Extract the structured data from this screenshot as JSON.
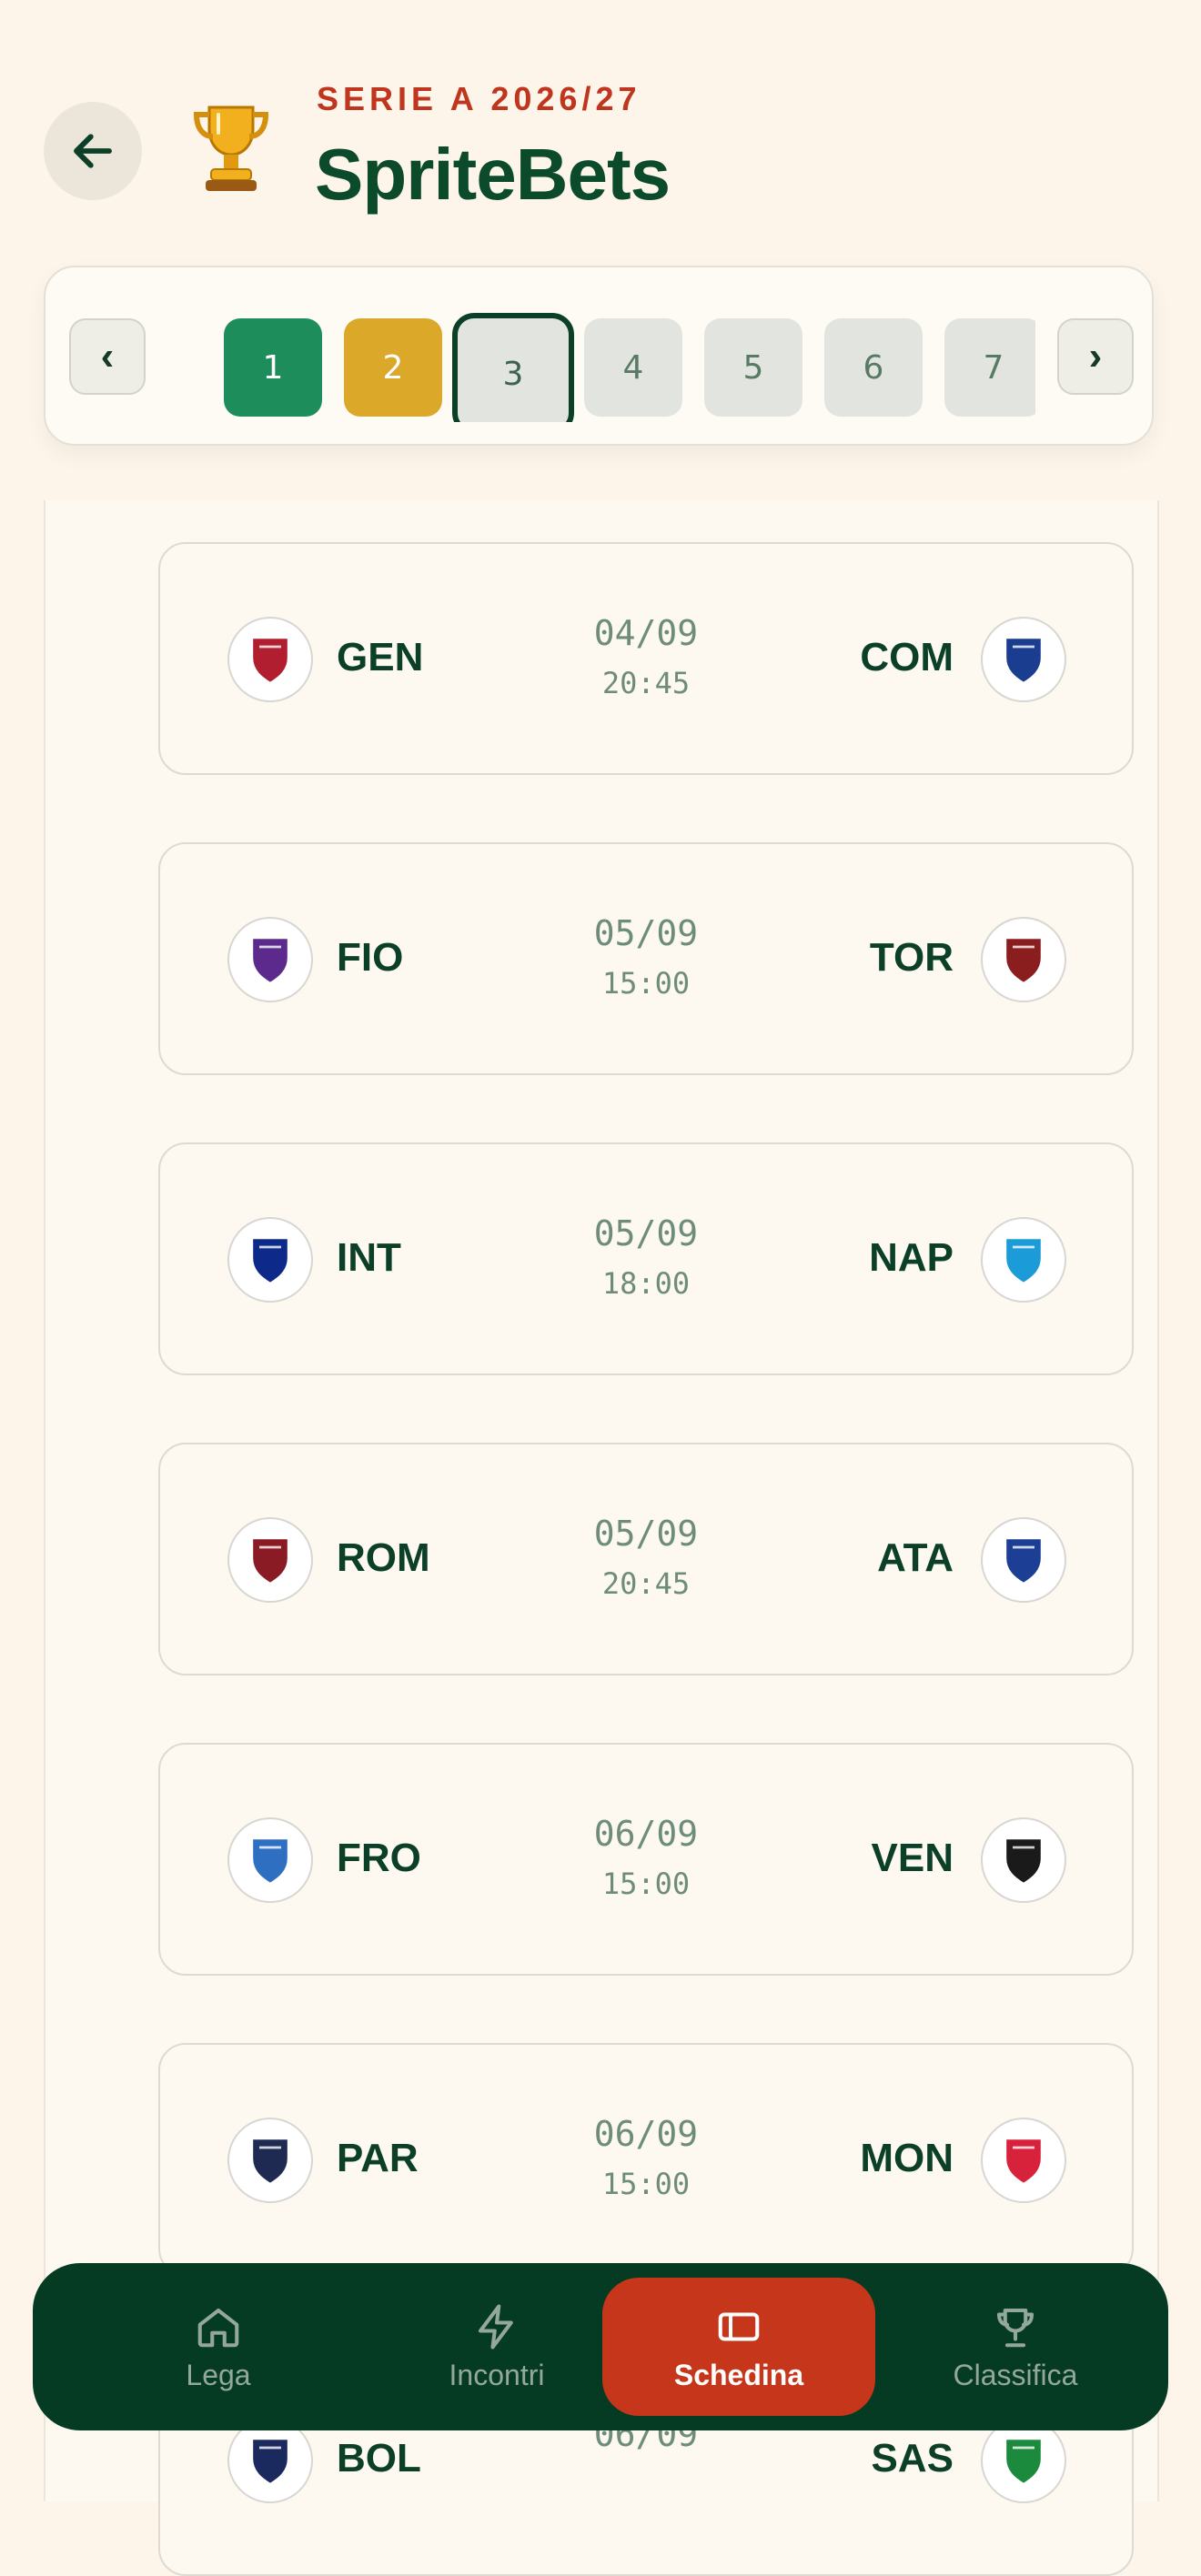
{
  "header": {
    "league": "SERIE A 2026/27",
    "title": "SpriteBets"
  },
  "rounds": {
    "prev_label": "‹",
    "next_label": "›",
    "items": [
      "1",
      "2",
      "3",
      "4",
      "5",
      "6",
      "7"
    ],
    "status": [
      "done",
      "live",
      "current",
      "upcoming",
      "upcoming",
      "upcoming",
      "upcoming"
    ],
    "selected": "3"
  },
  "matches": [
    {
      "home": "GEN",
      "away": "COM",
      "date": "04/09",
      "time": "20:45",
      "home_color": "#b01e2f",
      "away_color": "#1a3d8f"
    },
    {
      "home": "FIO",
      "away": "TOR",
      "date": "05/09",
      "time": "15:00",
      "home_color": "#5b2a8c",
      "away_color": "#8a1d1d"
    },
    {
      "home": "INT",
      "away": "NAP",
      "date": "05/09",
      "time": "18:00",
      "home_color": "#0d2a8a",
      "away_color": "#1b9bd8"
    },
    {
      "home": "ROM",
      "away": "ATA",
      "date": "05/09",
      "time": "20:45",
      "home_color": "#8a1a23",
      "away_color": "#1c3f95"
    },
    {
      "home": "FRO",
      "away": "VEN",
      "date": "06/09",
      "time": "15:00",
      "home_color": "#2f6fc2",
      "away_color": "#1a1a1a"
    },
    {
      "home": "PAR",
      "away": "MON",
      "date": "06/09",
      "time": "15:00",
      "home_color": "#1f2a52",
      "away_color": "#d8213a"
    },
    {
      "home": "BOL",
      "away": "SAS",
      "date": "06/09",
      "time": "",
      "home_color": "#1a2a5e",
      "away_color": "#1b8a3c"
    }
  ],
  "nav": {
    "items": [
      {
        "label": "Lega",
        "icon": "home-icon"
      },
      {
        "label": "Incontri",
        "icon": "lightning-icon"
      },
      {
        "label": "Schedina",
        "icon": "ticket-icon"
      },
      {
        "label": "Classifica",
        "icon": "trophy-icon"
      }
    ],
    "active": "Schedina"
  },
  "colors": {
    "accent_red": "#c5361b",
    "brand_green": "#0c3f27",
    "round_done": "#1e8d5c",
    "round_live": "#dba82a",
    "background": "#fdf5ea"
  }
}
